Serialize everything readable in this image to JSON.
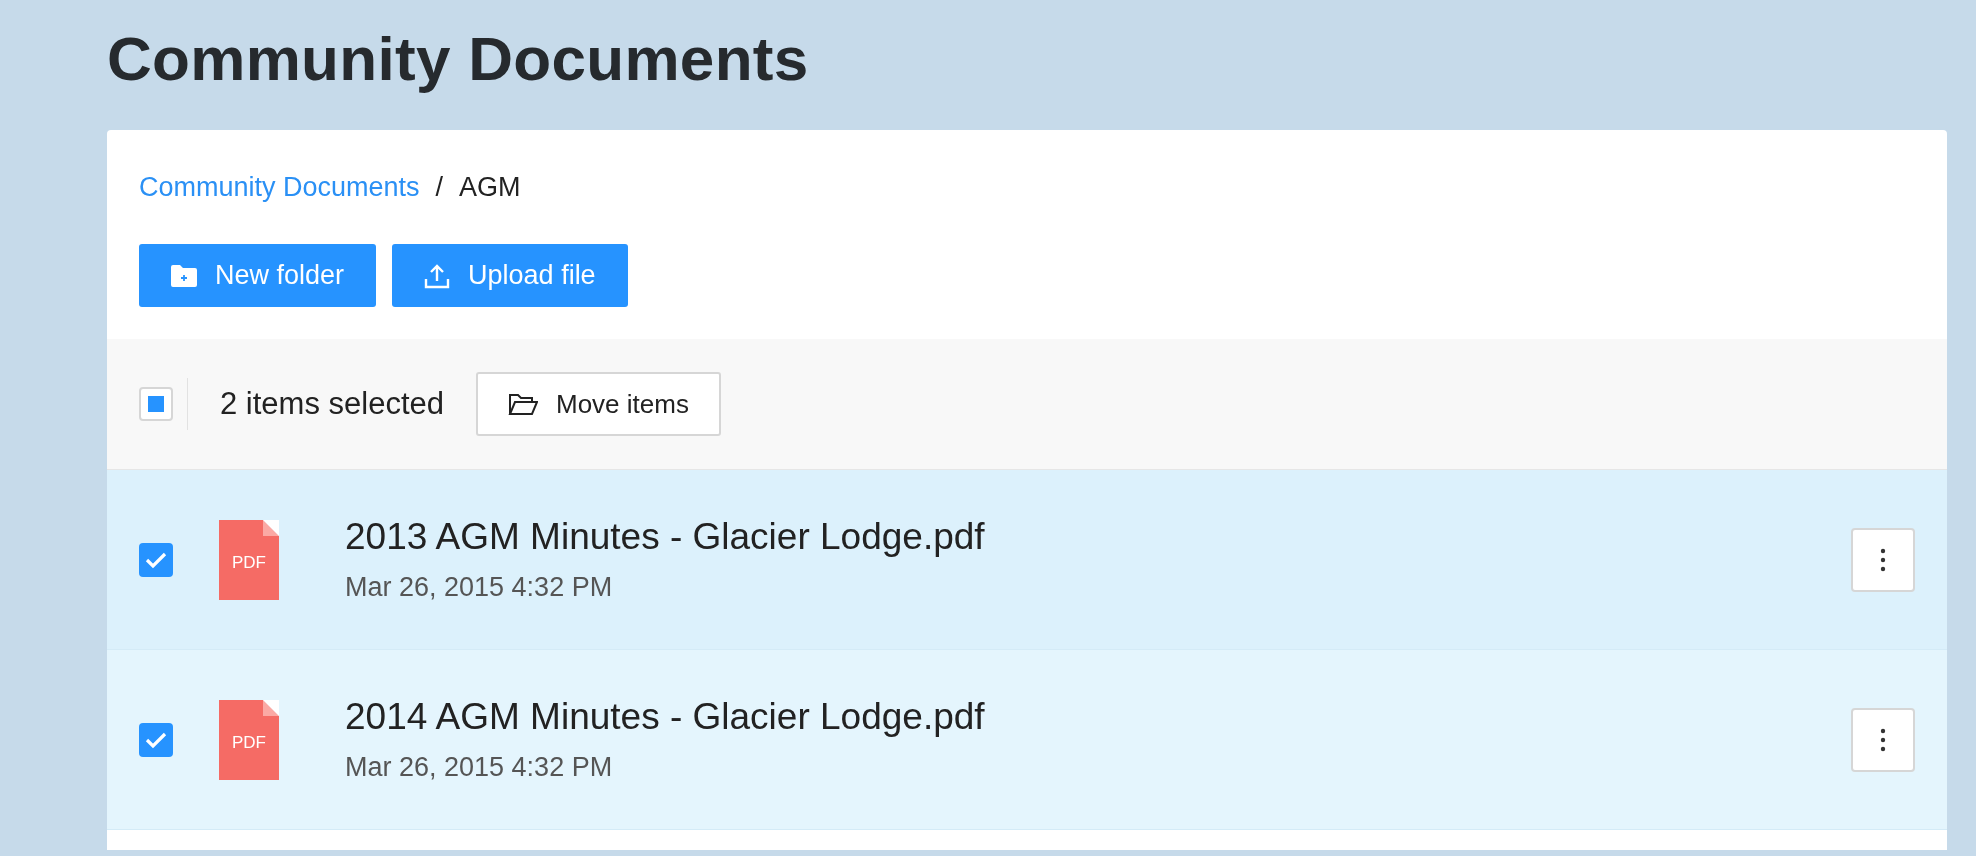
{
  "page_title": "Community Documents",
  "breadcrumb": [
    {
      "label": "Community Documents",
      "kind": "link"
    },
    {
      "label": "/",
      "kind": "separator"
    },
    {
      "label": "AGM",
      "kind": "current"
    }
  ],
  "actions": [
    {
      "label": "New folder",
      "kind": "new-folder"
    },
    {
      "label": "Upload file",
      "kind": "upload"
    }
  ],
  "selection_bar": {
    "select_all": {
      "indeterminate": true
    },
    "count_label": "2 items selected",
    "move_button": "Move items"
  },
  "files": [
    {
      "name": "2013 AGM Minutes - Glacier Lodge.pdf",
      "date": "Mar 26, 2015 4:32 PM",
      "type_label": "PDF",
      "checked": true
    },
    {
      "name": "2014 AGM Minutes - Glacier Lodge.pdf",
      "date": "Mar 26, 2015 4:32 PM",
      "type_label": "PDF",
      "checked": true
    }
  ]
}
